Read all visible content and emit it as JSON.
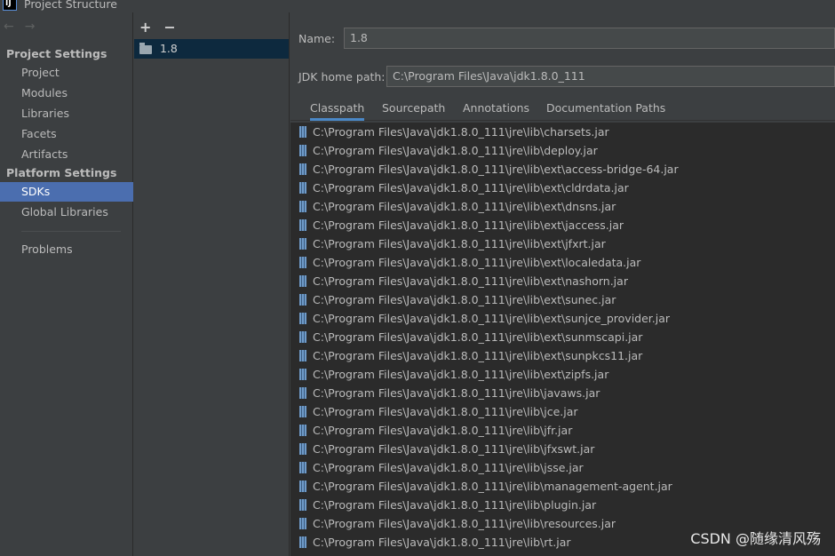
{
  "window": {
    "title": "Project Structure"
  },
  "nav": {
    "back": "←",
    "forward": "→",
    "project_settings_header": "Project Settings",
    "project_items": [
      "Project",
      "Modules",
      "Libraries",
      "Facets",
      "Artifacts"
    ],
    "platform_settings_header": "Platform Settings",
    "platform_items": [
      "SDKs",
      "Global Libraries"
    ],
    "problems": "Problems",
    "selected": "SDKs"
  },
  "sdk_list": {
    "add": "+",
    "remove": "−",
    "items": [
      "1.8"
    ]
  },
  "details": {
    "name_label": "Name:",
    "name_value": "1.8",
    "jdk_home_label": "JDK home path:",
    "jdk_home_value": "C:\\Program Files\\Java\\jdk1.8.0_111",
    "tabs": [
      "Classpath",
      "Sourcepath",
      "Annotations",
      "Documentation Paths"
    ],
    "active_tab": "Classpath",
    "classpath": [
      "C:\\Program Files\\Java\\jdk1.8.0_111\\jre\\lib\\charsets.jar",
      "C:\\Program Files\\Java\\jdk1.8.0_111\\jre\\lib\\deploy.jar",
      "C:\\Program Files\\Java\\jdk1.8.0_111\\jre\\lib\\ext\\access-bridge-64.jar",
      "C:\\Program Files\\Java\\jdk1.8.0_111\\jre\\lib\\ext\\cldrdata.jar",
      "C:\\Program Files\\Java\\jdk1.8.0_111\\jre\\lib\\ext\\dnsns.jar",
      "C:\\Program Files\\Java\\jdk1.8.0_111\\jre\\lib\\ext\\jaccess.jar",
      "C:\\Program Files\\Java\\jdk1.8.0_111\\jre\\lib\\ext\\jfxrt.jar",
      "C:\\Program Files\\Java\\jdk1.8.0_111\\jre\\lib\\ext\\localedata.jar",
      "C:\\Program Files\\Java\\jdk1.8.0_111\\jre\\lib\\ext\\nashorn.jar",
      "C:\\Program Files\\Java\\jdk1.8.0_111\\jre\\lib\\ext\\sunec.jar",
      "C:\\Program Files\\Java\\jdk1.8.0_111\\jre\\lib\\ext\\sunjce_provider.jar",
      "C:\\Program Files\\Java\\jdk1.8.0_111\\jre\\lib\\ext\\sunmscapi.jar",
      "C:\\Program Files\\Java\\jdk1.8.0_111\\jre\\lib\\ext\\sunpkcs11.jar",
      "C:\\Program Files\\Java\\jdk1.8.0_111\\jre\\lib\\ext\\zipfs.jar",
      "C:\\Program Files\\Java\\jdk1.8.0_111\\jre\\lib\\javaws.jar",
      "C:\\Program Files\\Java\\jdk1.8.0_111\\jre\\lib\\jce.jar",
      "C:\\Program Files\\Java\\jdk1.8.0_111\\jre\\lib\\jfr.jar",
      "C:\\Program Files\\Java\\jdk1.8.0_111\\jre\\lib\\jfxswt.jar",
      "C:\\Program Files\\Java\\jdk1.8.0_111\\jre\\lib\\jsse.jar",
      "C:\\Program Files\\Java\\jdk1.8.0_111\\jre\\lib\\management-agent.jar",
      "C:\\Program Files\\Java\\jdk1.8.0_111\\jre\\lib\\plugin.jar",
      "C:\\Program Files\\Java\\jdk1.8.0_111\\jre\\lib\\resources.jar",
      "C:\\Program Files\\Java\\jdk1.8.0_111\\jre\\lib\\rt.jar"
    ]
  },
  "watermark": "CSDN @随缘清风殇",
  "colors": {
    "background": "#3c3f41",
    "list_background": "#2b2b2b",
    "selection": "#4b6eaf",
    "tab_underline": "#4a88c7"
  }
}
